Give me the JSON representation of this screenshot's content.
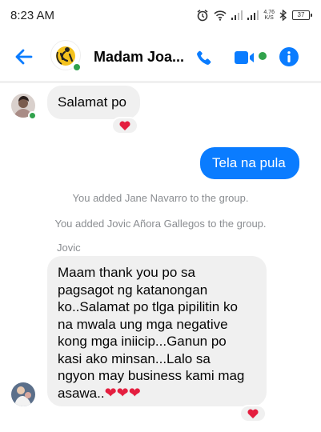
{
  "status_bar": {
    "time": "8:23 AM",
    "net_speed_value": "4.76",
    "net_speed_unit": "K/S",
    "battery": "37",
    "icons": [
      "alarm-icon",
      "wifi-icon",
      "signal-icon",
      "signal-icon",
      "bluetooth-icon",
      "battery-icon"
    ]
  },
  "header": {
    "contact_name": "Madam Joa...",
    "online": true,
    "accent_color": "#0a7cff",
    "online_color": "#31a24c",
    "icons": [
      "back-arrow-icon",
      "phone-icon",
      "video-camera-icon",
      "info-icon"
    ]
  },
  "messages": [
    {
      "type": "incoming",
      "sender": "Madam Joa...",
      "text": "Salamat po",
      "reaction": "heart"
    },
    {
      "type": "outgoing",
      "text": "Tela na pula"
    },
    {
      "type": "system",
      "text": "You added Jane Navarro to the group."
    },
    {
      "type": "system",
      "text": "You added Jovic Añora Gallegos to the group."
    },
    {
      "type": "incoming",
      "sender": "Jovic",
      "lines": [
        "Maam thank you po sa",
        "pagsagot ng katanongan",
        "ko..Salamat po tlga pipilitin ko",
        "na mwala ung mga negative",
        "kong mga iniicip...Ganun po",
        "kasi ako minsan...Lalo sa",
        "ngyon may business kami mag",
        "asawa.."
      ],
      "trailing_emoji": "❤❤❤",
      "reaction": "heart"
    }
  ]
}
